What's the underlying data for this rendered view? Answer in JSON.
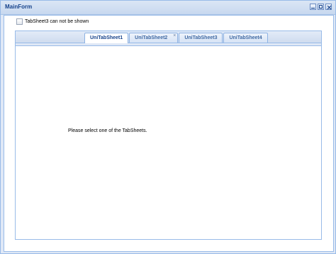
{
  "window": {
    "title": "MainForm",
    "tools": [
      "minimize-icon",
      "maximize-icon",
      "close-icon"
    ]
  },
  "checkbox": {
    "label": "TabSheet3 can not be shown",
    "checked": false
  },
  "tabs": [
    {
      "label": "UniTabSheet1",
      "active": true
    },
    {
      "label": "UniTabSheet2",
      "closable": true
    },
    {
      "label": "UniTabSheet3"
    },
    {
      "label": "UniTabSheet4"
    }
  ],
  "tab_close_glyph": "×",
  "content": {
    "message": "Please select one of the TabSheets."
  },
  "colors": {
    "title_text": "#15428b",
    "border": "#99bbe8",
    "frame": "#dfe8f6"
  }
}
